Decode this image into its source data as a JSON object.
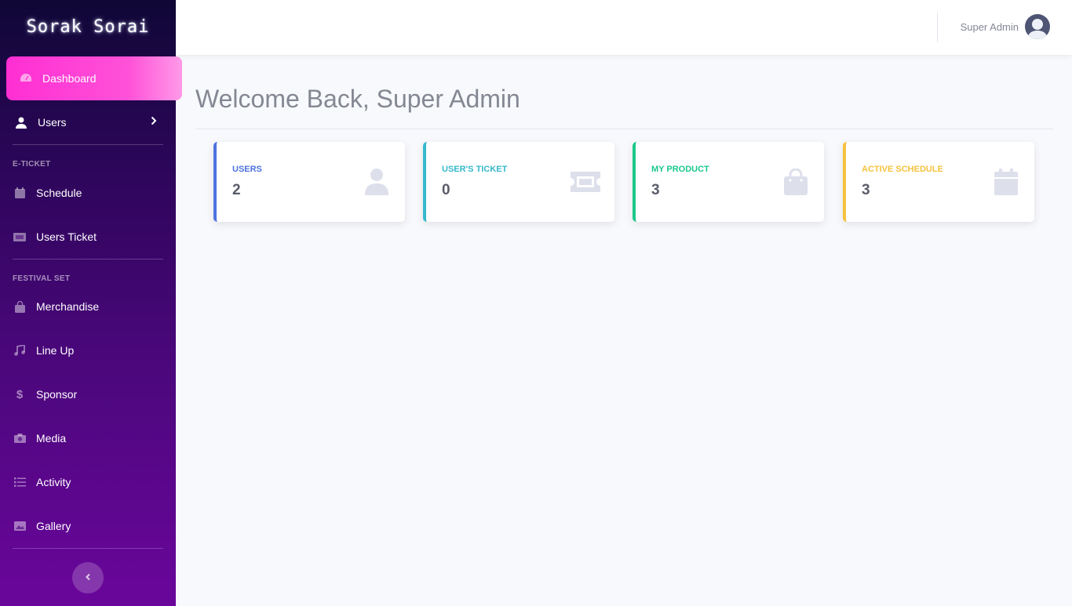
{
  "brand": {
    "name": "Sorak Sorai"
  },
  "sidebar": {
    "items": [
      {
        "label": "Dashboard",
        "icon": "gauge-icon",
        "active": true
      },
      {
        "label": "Users",
        "icon": "user-icon"
      },
      {
        "label": "Schedule",
        "icon": "calendar-icon"
      },
      {
        "label": "Users Ticket",
        "icon": "ticket-icon"
      },
      {
        "label": "Merchandise",
        "icon": "shopping-bag-icon"
      },
      {
        "label": "Line Up",
        "icon": "music-icon"
      },
      {
        "label": "Sponsor",
        "icon": "dollar-icon"
      },
      {
        "label": "Media",
        "icon": "camera-icon"
      },
      {
        "label": "Activity",
        "icon": "list-icon"
      },
      {
        "label": "Gallery",
        "icon": "image-icon"
      }
    ],
    "sections": {
      "eticket": "E-TICKET",
      "festival": "FESTIVAL SET"
    }
  },
  "topbar": {
    "user_name": "Super Admin"
  },
  "main": {
    "title": "Welcome Back, Super Admin",
    "cards": [
      {
        "label": "USERS",
        "value": "2",
        "icon": "user-icon",
        "color": "#4e73df"
      },
      {
        "label": "USER'S TICKET",
        "value": "0",
        "icon": "ticket-icon",
        "color": "#36b9cc"
      },
      {
        "label": "MY PRODUCT",
        "value": "3",
        "icon": "shopping-bag-icon",
        "color": "#1cc88a"
      },
      {
        "label": "ACTIVE SCHEDULE",
        "value": "3",
        "icon": "calendar-icon",
        "color": "#f6c23e"
      }
    ]
  },
  "colors": {
    "active_nav": "#ff2ed3",
    "icon_muted": "#dddfeb"
  }
}
